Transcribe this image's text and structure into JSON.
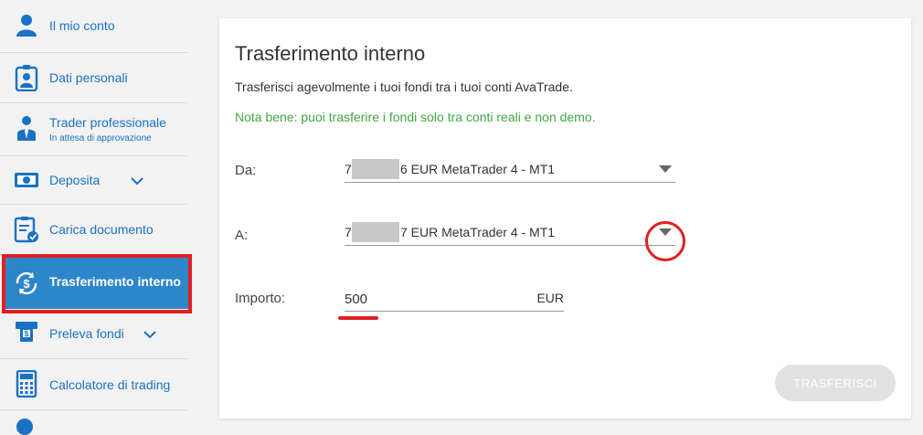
{
  "sidebar": {
    "items": [
      {
        "label": "Il mio conto",
        "icon": "user-icon"
      },
      {
        "label": "Dati personali",
        "icon": "id-badge-icon"
      },
      {
        "label": "Trader professionale",
        "sub": "In attesa di approvazione",
        "icon": "professional-user-icon"
      },
      {
        "label": "Deposita",
        "icon": "banknote-icon"
      },
      {
        "label": "Carica documento",
        "icon": "clipboard-check-icon"
      },
      {
        "label": "Trasferimento interno",
        "icon": "transfer-dollar-icon"
      },
      {
        "label": "Preleva fondi",
        "icon": "atm-withdraw-icon"
      },
      {
        "label": "Calcolatore di trading",
        "icon": "calculator-icon"
      }
    ]
  },
  "form": {
    "title": "Trasferimento interno",
    "subtitle": "Trasferisci agevolmente i tuoi fondi tra i tuoi conti AvaTrade.",
    "note": "Nota bene: puoi trasferire i fondi solo tra conti reali e non demo.",
    "from": {
      "label": "Da:",
      "prefix": "7",
      "suffix": "6 EUR MetaTrader 4 - MT1"
    },
    "to": {
      "label": "A:",
      "prefix": "7",
      "suffix": "7 EUR MetaTrader 4 - MT1"
    },
    "amount": {
      "label": "Importo:",
      "value": "500",
      "currency": "EUR"
    },
    "submit_label": "TRASFERISCI"
  },
  "colors": {
    "link_blue": "#1a72c4",
    "active_bg": "#2c86c9",
    "note_green": "#3ea83e",
    "annotation_red": "#e02020"
  }
}
